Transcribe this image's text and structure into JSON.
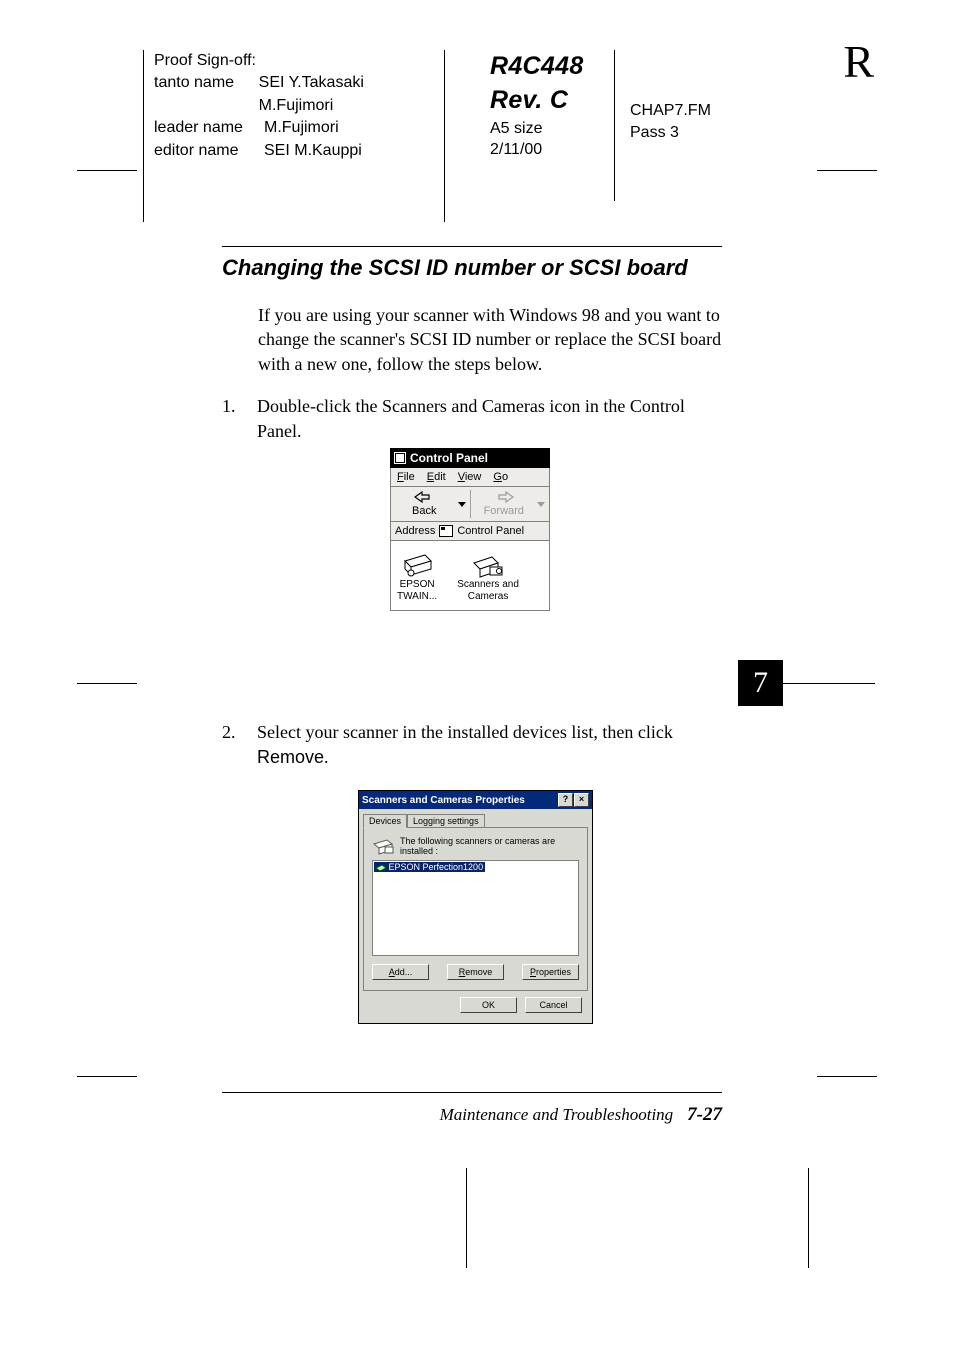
{
  "header": {
    "proof_signoff": "Proof Sign-off:",
    "rows": [
      {
        "label": "tanto name",
        "value": "SEI Y.Takasaki M.Fujimori"
      },
      {
        "label": "leader name",
        "value": "M.Fujimori"
      },
      {
        "label": "editor name",
        "value": "SEI M.Kauppi"
      }
    ],
    "doc_code": "R4C448",
    "rev": "Rev. C",
    "size": "A5 size",
    "date": "2/11/00",
    "chapfile": "CHAP7.FM",
    "pass": "Pass 3",
    "corner": "R"
  },
  "page": {
    "heading": "Changing the SCSI ID number or SCSI board",
    "intro": "If you are using your scanner with Windows 98 and you want to change the scanner's SCSI ID number or replace the SCSI board with a new one, follow the steps below.",
    "steps": [
      {
        "n": "1.",
        "text_a": "Double-click the Scanners and Cameras icon in the Control Panel.",
        "ui_word": ""
      },
      {
        "n": "2.",
        "text_a": "Select your scanner in the installed devices list, then click ",
        "ui_word": "Remove",
        "text_b": "."
      }
    ],
    "chapter_tab": "7"
  },
  "fig1": {
    "title": "Control Panel",
    "menu": {
      "file": "File",
      "edit": "Edit",
      "view": "View",
      "go": "Go"
    },
    "tools": {
      "back": "Back",
      "forward": "Forward"
    },
    "address_label": "Address",
    "address_value": "Control Panel",
    "icons": [
      {
        "name": "epson-twain-icon",
        "label_a": "EPSON",
        "label_b": "TWAIN..."
      },
      {
        "name": "scanners-cameras-icon",
        "label_a": "Scanners and",
        "label_b": "Cameras"
      }
    ]
  },
  "fig2": {
    "title": "Scanners and Cameras Properties",
    "help_btn": "?",
    "close_btn": "×",
    "tabs": {
      "devices": "Devices",
      "logging": "Logging settings"
    },
    "caption": "The following scanners or cameras are installed :",
    "list_item": "EPSON Perfection1200",
    "buttons": {
      "add": "Add...",
      "remove": "Remove",
      "properties": "Properties",
      "ok": "OK",
      "cancel": "Cancel"
    }
  },
  "footer": {
    "section": "Maintenance and Troubleshooting",
    "page_no": "7-27"
  }
}
